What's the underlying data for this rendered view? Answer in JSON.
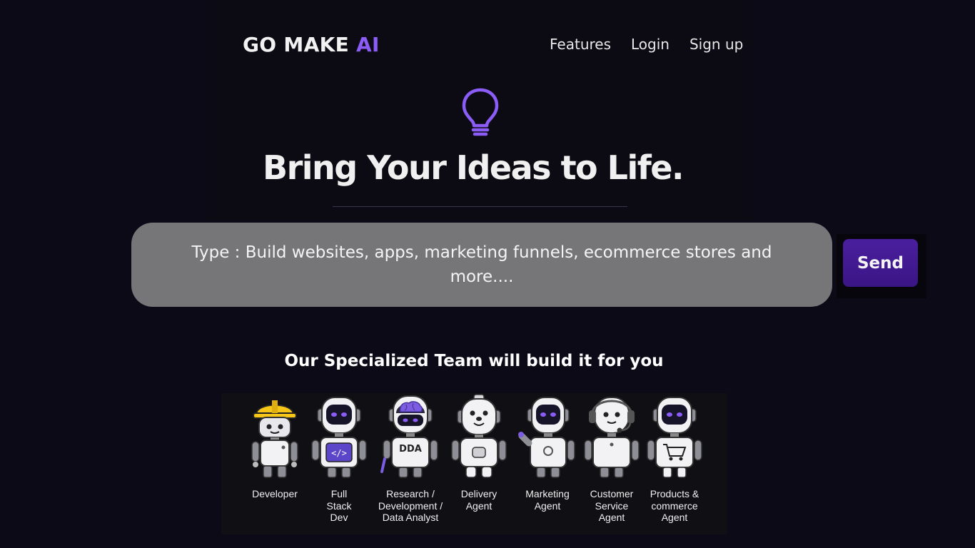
{
  "brand": {
    "name_main": "GO MAKE ",
    "name_accent": "AI",
    "accent_color": "#8b5cf6"
  },
  "nav": {
    "items": [
      {
        "label": "Features"
      },
      {
        "label": "Login"
      },
      {
        "label": "Sign up"
      }
    ]
  },
  "hero": {
    "icon": "lightbulb-icon",
    "headline": "Bring Your Ideas to Life."
  },
  "prompt": {
    "placeholder": "Type : Build websites, apps, marketing funnels, ecommerce stores and more...."
  },
  "send": {
    "label": "Send",
    "color": "#4a1f9e"
  },
  "team": {
    "heading": "Our Specialized Team will build it for you",
    "agents": [
      {
        "label": "Developer",
        "icon": "hard-hat-robot-icon"
      },
      {
        "label": "Full Stack Dev",
        "icon": "code-robot-icon"
      },
      {
        "label": "Research / Development / Data Analyst",
        "icon": "brain-robot-icon",
        "badge": "DDA"
      },
      {
        "label": "Delivery Agent",
        "icon": "dog-robot-icon"
      },
      {
        "label": "Marketing Agent",
        "icon": "waving-robot-icon"
      },
      {
        "label": "Customer Service Agent",
        "icon": "headset-robot-icon"
      },
      {
        "label": "Products & commerce Agent",
        "icon": "cart-robot-icon"
      }
    ]
  }
}
